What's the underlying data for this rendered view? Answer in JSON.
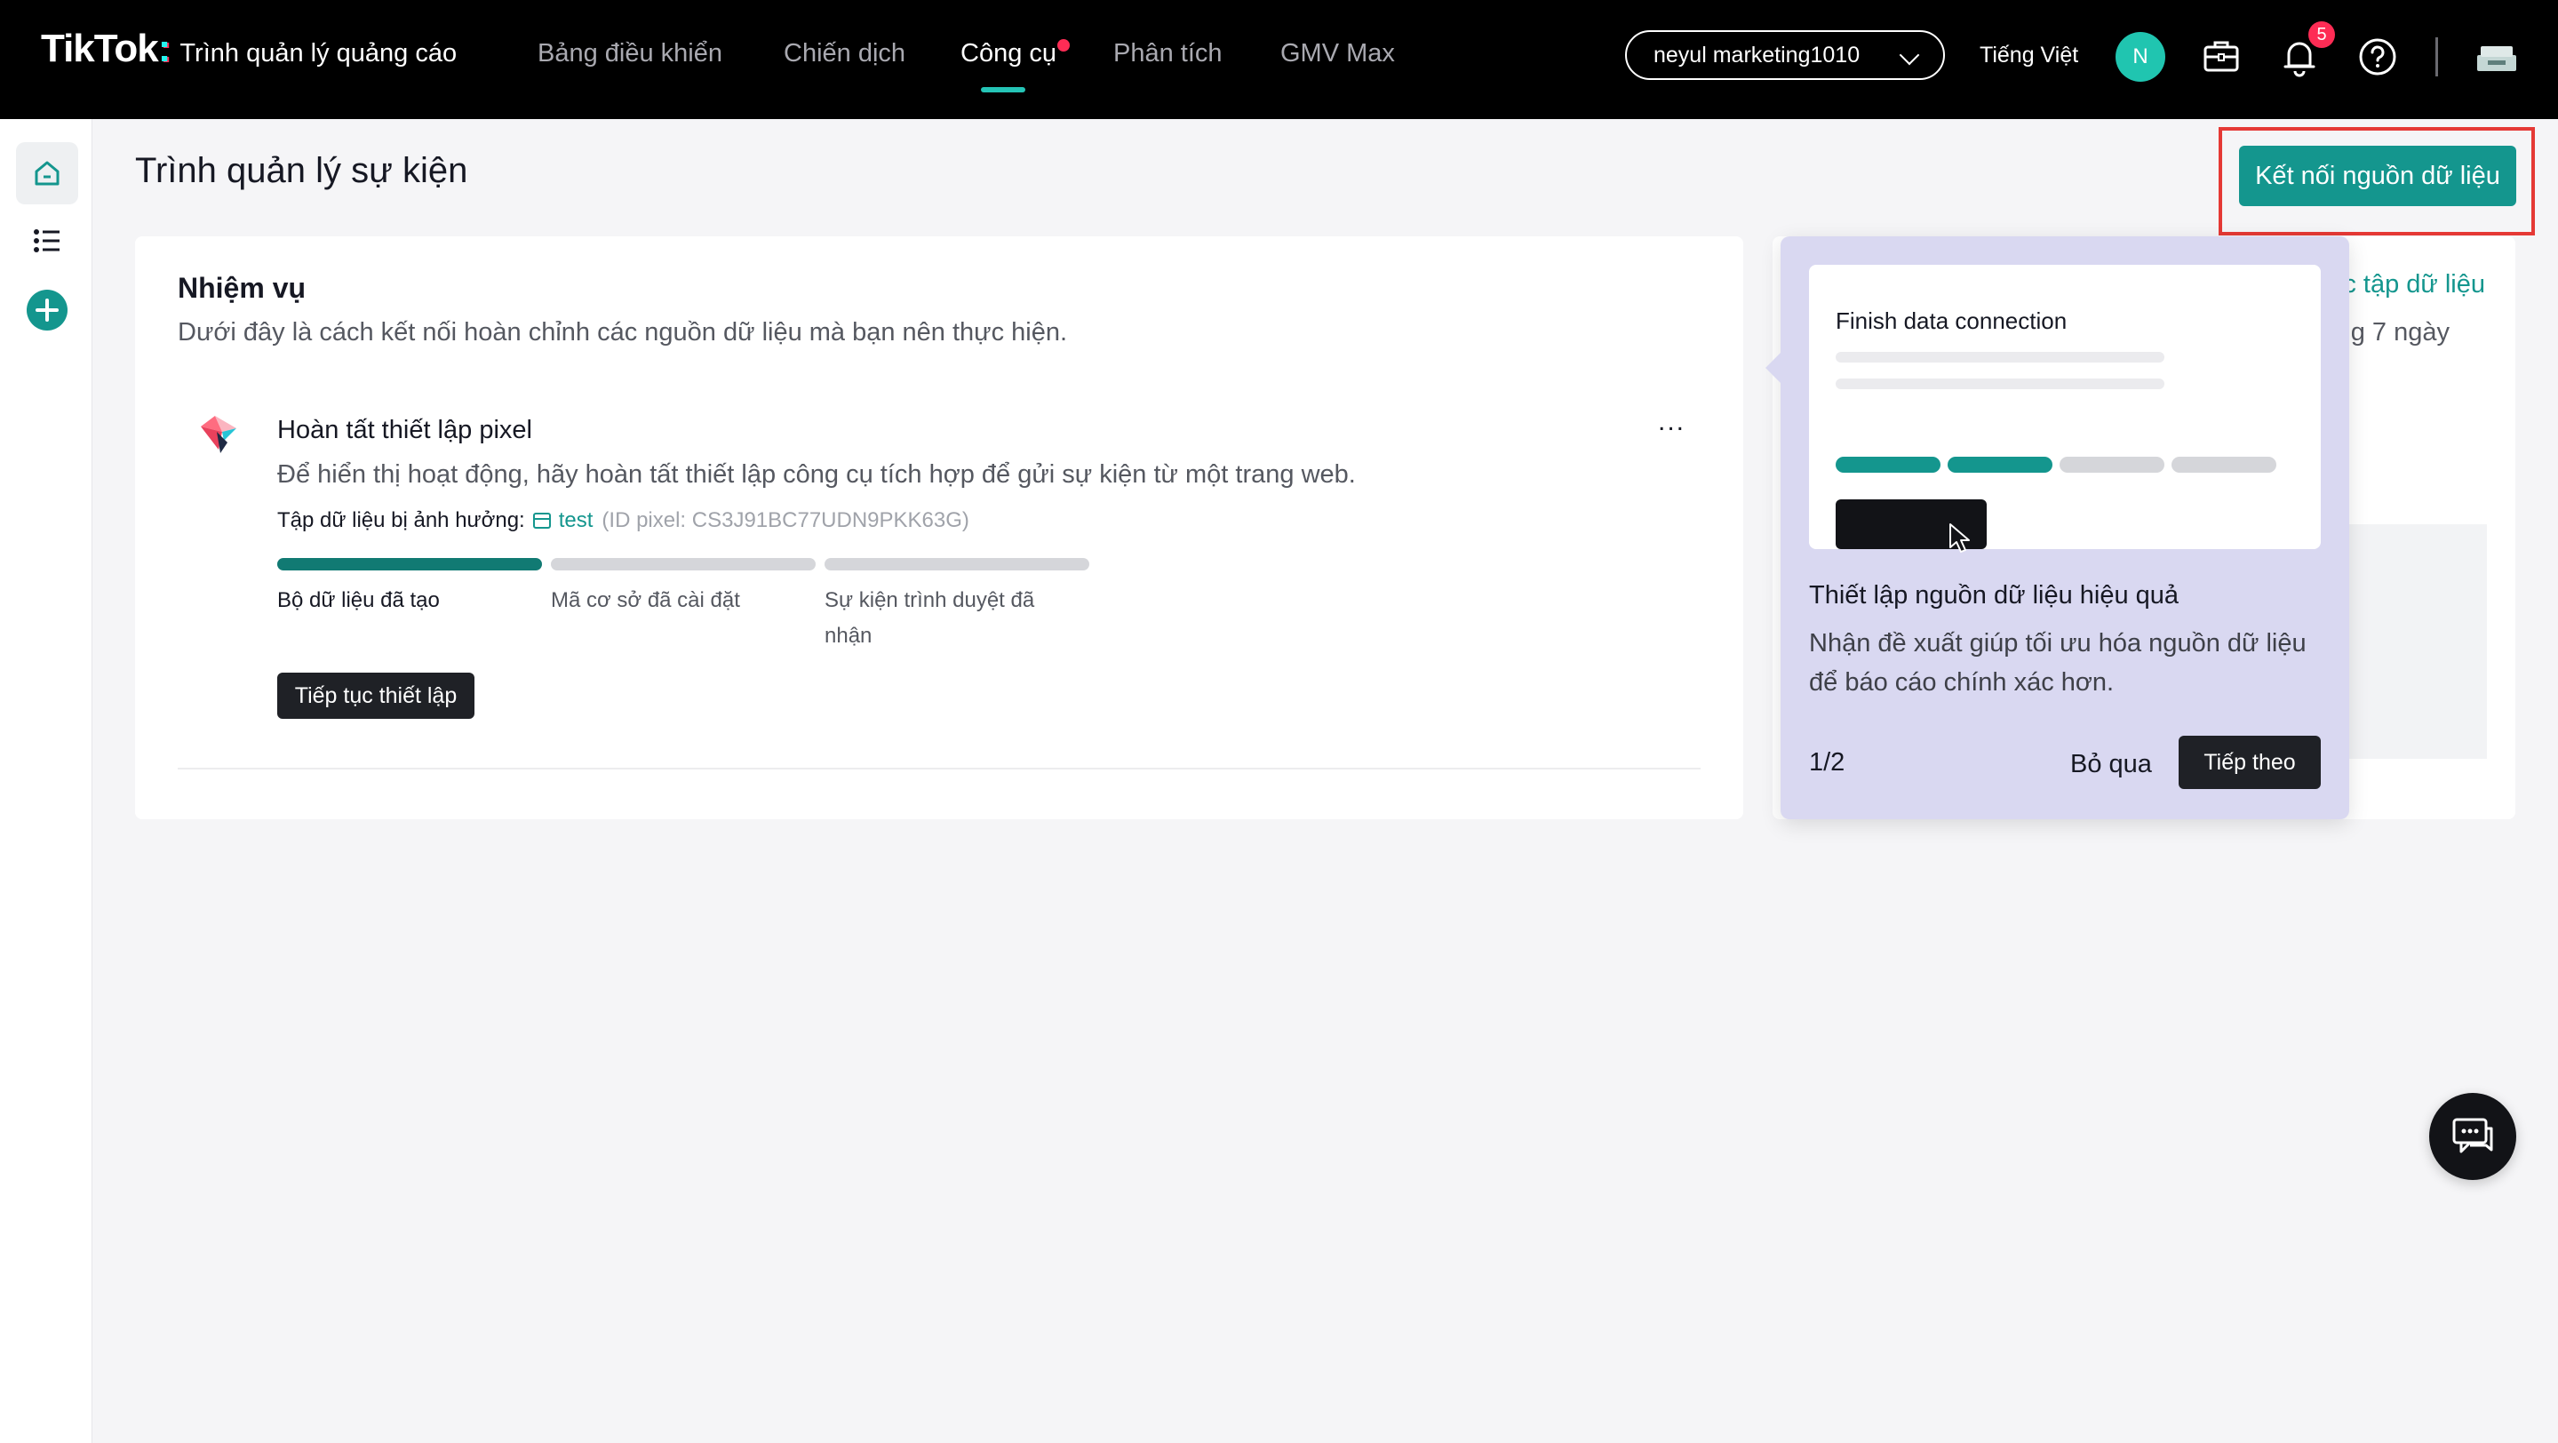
{
  "header": {
    "brand": "TikTok",
    "colon": ":",
    "product": "Trình quản lý quảng cáo",
    "nav": [
      {
        "label": "Bảng điều khiển"
      },
      {
        "label": "Chiến dịch"
      },
      {
        "label": "Công cụ"
      },
      {
        "label": "Phân tích"
      },
      {
        "label": "GMV Max"
      }
    ],
    "account": "neyul marketing1010",
    "language": "Tiếng Việt",
    "avatar_initial": "N",
    "notification_count": "5"
  },
  "page": {
    "title": "Trình quản lý sự kiện",
    "primary_button": "Kết nối nguồn dữ liệu"
  },
  "tasks": {
    "title": "Nhiệm vụ",
    "subtitle": "Dưới đây là cách kết nối hoàn chỉnh các nguồn dữ liệu mà bạn nên thực hiện.",
    "item": {
      "title": "Hoàn tất thiết lập pixel",
      "description": "Để hiển thị hoạt động, hãy hoàn tất thiết lập công cụ tích hợp để gửi sự kiện từ một trang web.",
      "dataset_label": "Tập dữ liệu bị ảnh hưởng:",
      "dataset_name": "test",
      "dataset_id": "(ID pixel: CS3J91BC77UDN9PKK63G)",
      "more": "...",
      "steps": [
        {
          "label": "Bộ dữ liệu đã tạo",
          "done": true
        },
        {
          "label": "Mã cơ sở đã cài đặt",
          "done": false
        },
        {
          "label": "Sự kiện trình duyệt đã nhận",
          "done": false
        }
      ],
      "continue_button": "Tiếp tục thiết lập"
    }
  },
  "side_card": {
    "link_fragment": "c tập dữ liệu",
    "text_fragment": "ng 7 ngày"
  },
  "popover": {
    "illustration_title": "Finish data connection",
    "title": "Thiết lập nguồn dữ liệu hiệu quả",
    "description": "Nhận đề xuất giúp tối ưu hóa nguồn dữ liệu để báo cáo chính xác hơn.",
    "counter": "1/2",
    "skip": "Bỏ qua",
    "next": "Tiếp theo"
  },
  "colors": {
    "accent": "#14968e",
    "highlight_box": "#e53935",
    "popover_bg": "#d9d8f1"
  }
}
